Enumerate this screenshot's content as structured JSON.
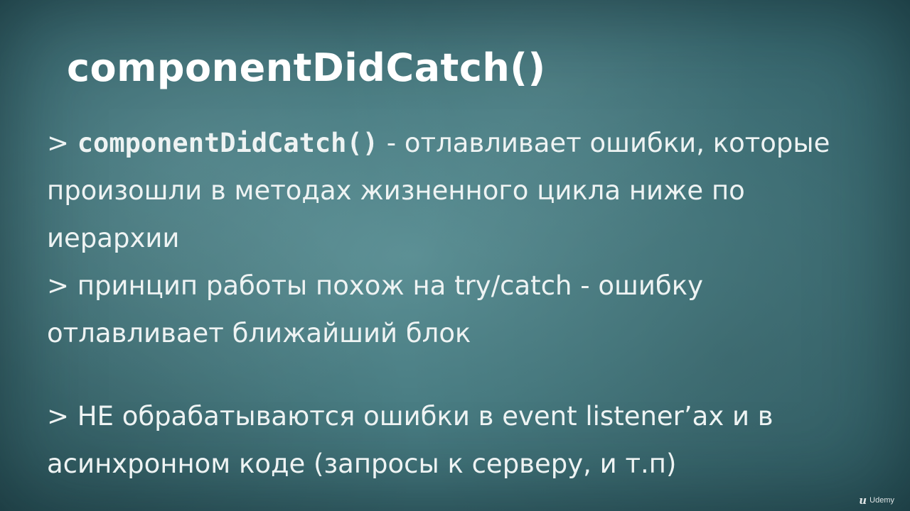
{
  "slide": {
    "title": "componentDidCatch()",
    "bullets": [
      {
        "marker": "> ",
        "code": "componentDidCatch()",
        "text": " - отлавливает ошибки, которые произошли в методах жизненного цикла ниже по иерархии"
      },
      {
        "marker": "> ",
        "text": "принцип работы похож на try/catch - ошибку отлавливает ближайший блок"
      },
      {
        "marker": "> ",
        "text": "НЕ обрабатываются ошибки в event listener’ах и в асинхронном коде (запросы к серверу, и т.п)"
      }
    ]
  },
  "watermark": {
    "icon": "udemy-logo-icon",
    "label": "Udemy"
  },
  "colors": {
    "background": "#4a7e84",
    "text": "#eef3f3"
  }
}
